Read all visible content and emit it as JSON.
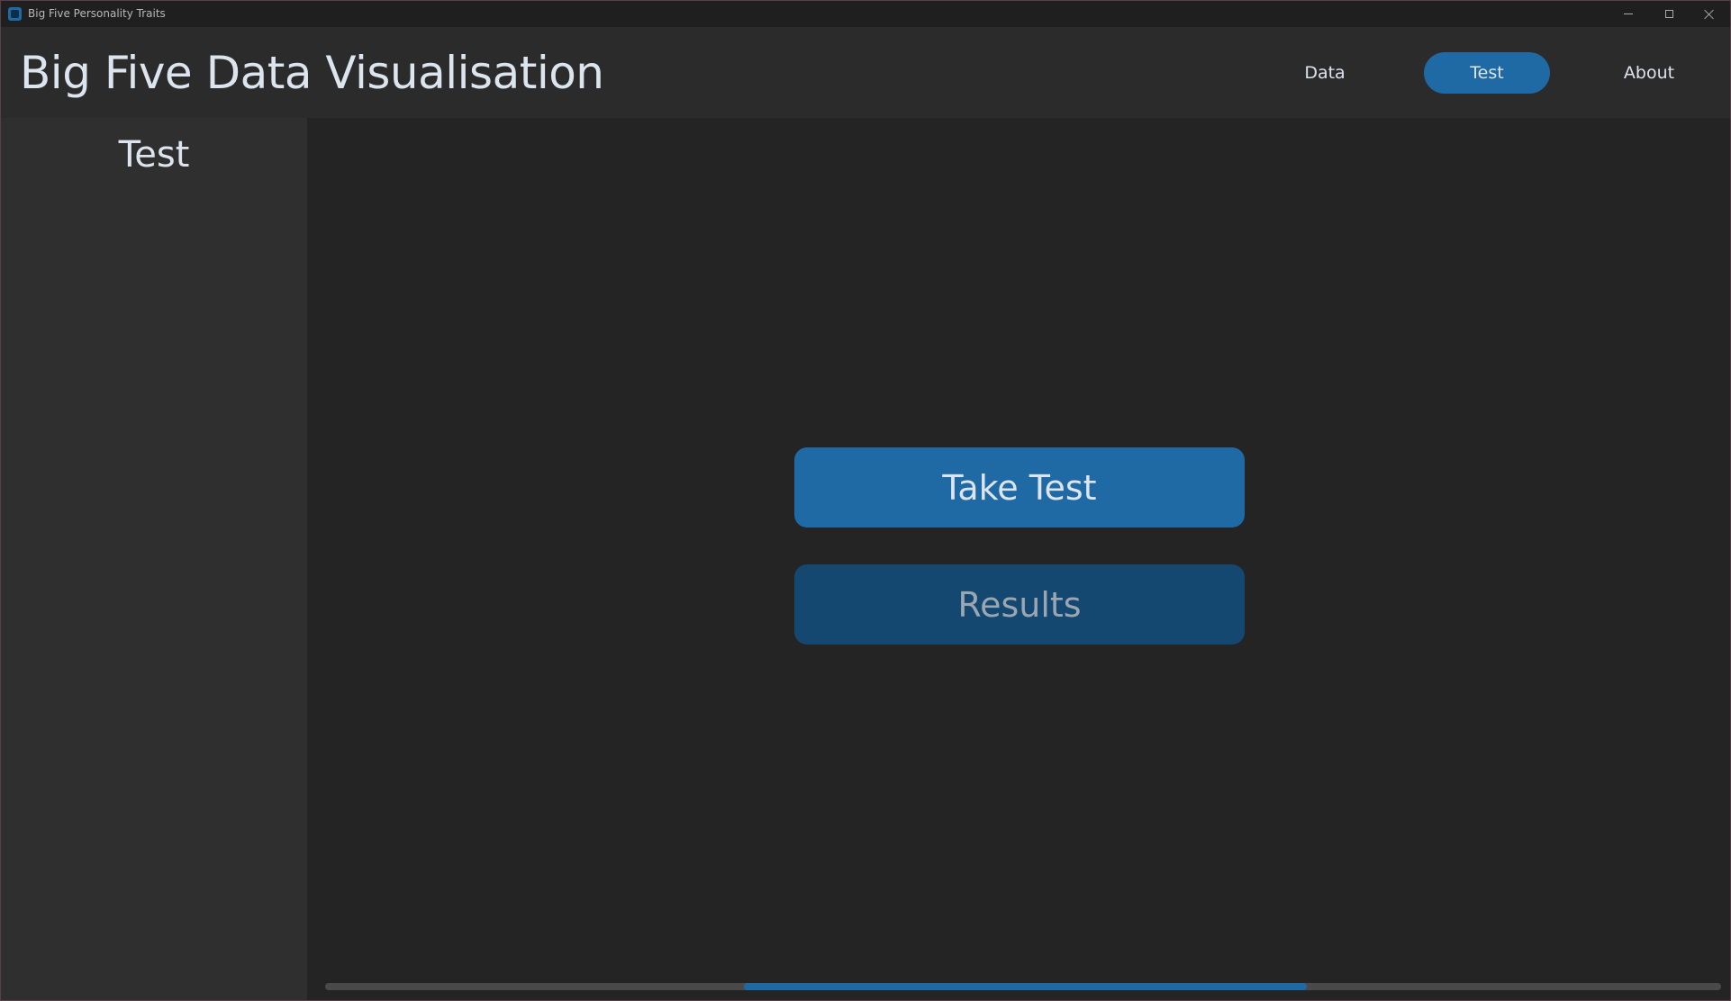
{
  "window": {
    "title": "Big Five Personality Traits",
    "controls": {
      "minimize_icon": "minimize-icon",
      "maximize_icon": "maximize-icon",
      "close_icon": "close-icon"
    }
  },
  "header": {
    "title": "Big Five Data Visualisation",
    "nav": [
      {
        "label": "Data",
        "active": false
      },
      {
        "label": "Test",
        "active": true
      },
      {
        "label": "About",
        "active": false
      }
    ]
  },
  "sidebar": {
    "title": "Test"
  },
  "main": {
    "take_test_label": "Take Test",
    "results_label": "Results",
    "results_enabled": false
  },
  "scrollbar": {
    "thumb_start_fraction": 0.3,
    "thumb_end_fraction": 0.703
  },
  "colors": {
    "accent": "#1f6aa5",
    "accent_disabled": "#144870",
    "background": "#242424",
    "header_bg": "#2b2b2b",
    "sidebar_bg": "#2f2f2f",
    "text": "#dce4ee"
  }
}
